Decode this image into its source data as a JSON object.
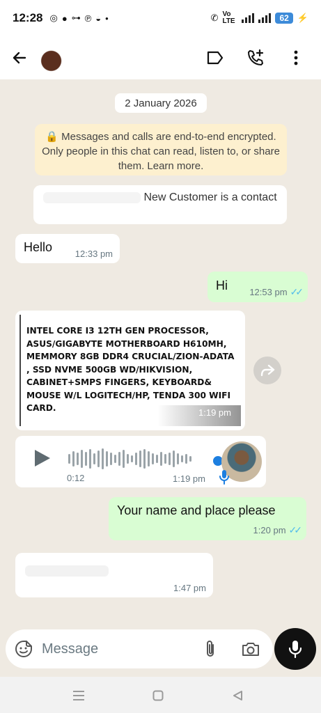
{
  "status_bar": {
    "time": "12:28",
    "network_label": "Vo LTE",
    "battery": "62"
  },
  "header": {
    "back_icon": "arrow-left-icon",
    "label_icon": "label-icon",
    "add_call_icon": "add-call-icon",
    "menu_icon": "more-vertical-icon"
  },
  "chat": {
    "date_chip": "2 January 2026",
    "encryption_notice": "🔒 Messages and calls are end-to-end encrypted. Only people in this chat can read, listen to, or share them. Learn more.",
    "system_notice_suffix": "New Customer is a contact",
    "messages": [
      {
        "direction": "in",
        "text": "Hello",
        "time": "12:33 pm"
      },
      {
        "direction": "out",
        "text": "Hi",
        "time": "12:53 pm",
        "read": true
      },
      {
        "direction": "in",
        "type": "image",
        "image_text": "INTEL CORE I3 12TH GEN PROCESSOR, ASUS/GIGABYTE MOTHERBOARD H610MH, MEMMORY 8GB DDR4 CRUCIAL/ZION-ADATA , SSD NVME 500GB WD/HIKVISION, CABINET+SMPS FINGERS, KEYBOARD& MOUSE W/L LOGITECH/HP, TENDA 300 WIFI CARD.",
        "time": "1:19 pm"
      },
      {
        "direction": "in",
        "type": "voice",
        "duration": "0:12",
        "time": "1:19 pm"
      },
      {
        "direction": "out",
        "text": "Your name and place please",
        "time": "1:20 pm",
        "read": true
      },
      {
        "direction": "in",
        "text": "",
        "time": "1:47 pm"
      }
    ]
  },
  "composer": {
    "placeholder": "Message"
  },
  "colors": {
    "outgoing_bubble": "#d9fdd3",
    "incoming_bubble": "#ffffff",
    "chat_background": "#efeae2",
    "read_ticks": "#53bdeb",
    "encryption_bg": "#fdf0cf"
  }
}
